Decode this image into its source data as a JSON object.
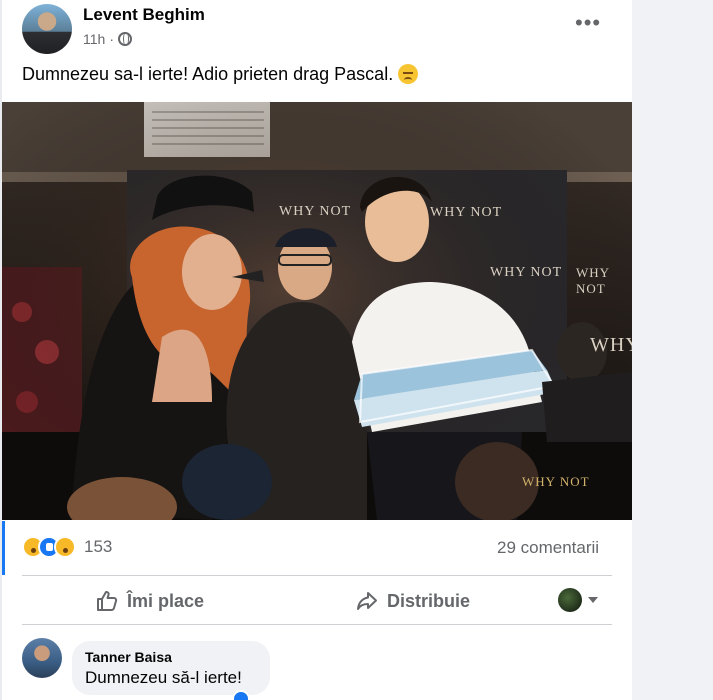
{
  "post": {
    "author": "Levent Beghim",
    "time": "11h",
    "separator": "·",
    "text": "Dumnezeu sa-l ierte! Adio prieten drag Pascal.",
    "more_icon": "•••"
  },
  "photo": {
    "signage": [
      "WHY NOT",
      "WHY NOT",
      "WHY NOT",
      "WHY NOT",
      "WHY"
    ],
    "logo": "WHY NOT"
  },
  "stats": {
    "reaction_count": "153",
    "comments": "29 comentarii"
  },
  "actions": {
    "like_label": "Îmi place",
    "share_label": "Distribuie"
  },
  "comment": {
    "author": "Tanner Baisa",
    "text": "Dumnezeu să-l ierte!"
  },
  "colors": {
    "accent": "#1877f2",
    "secondary_text": "#65676b"
  }
}
